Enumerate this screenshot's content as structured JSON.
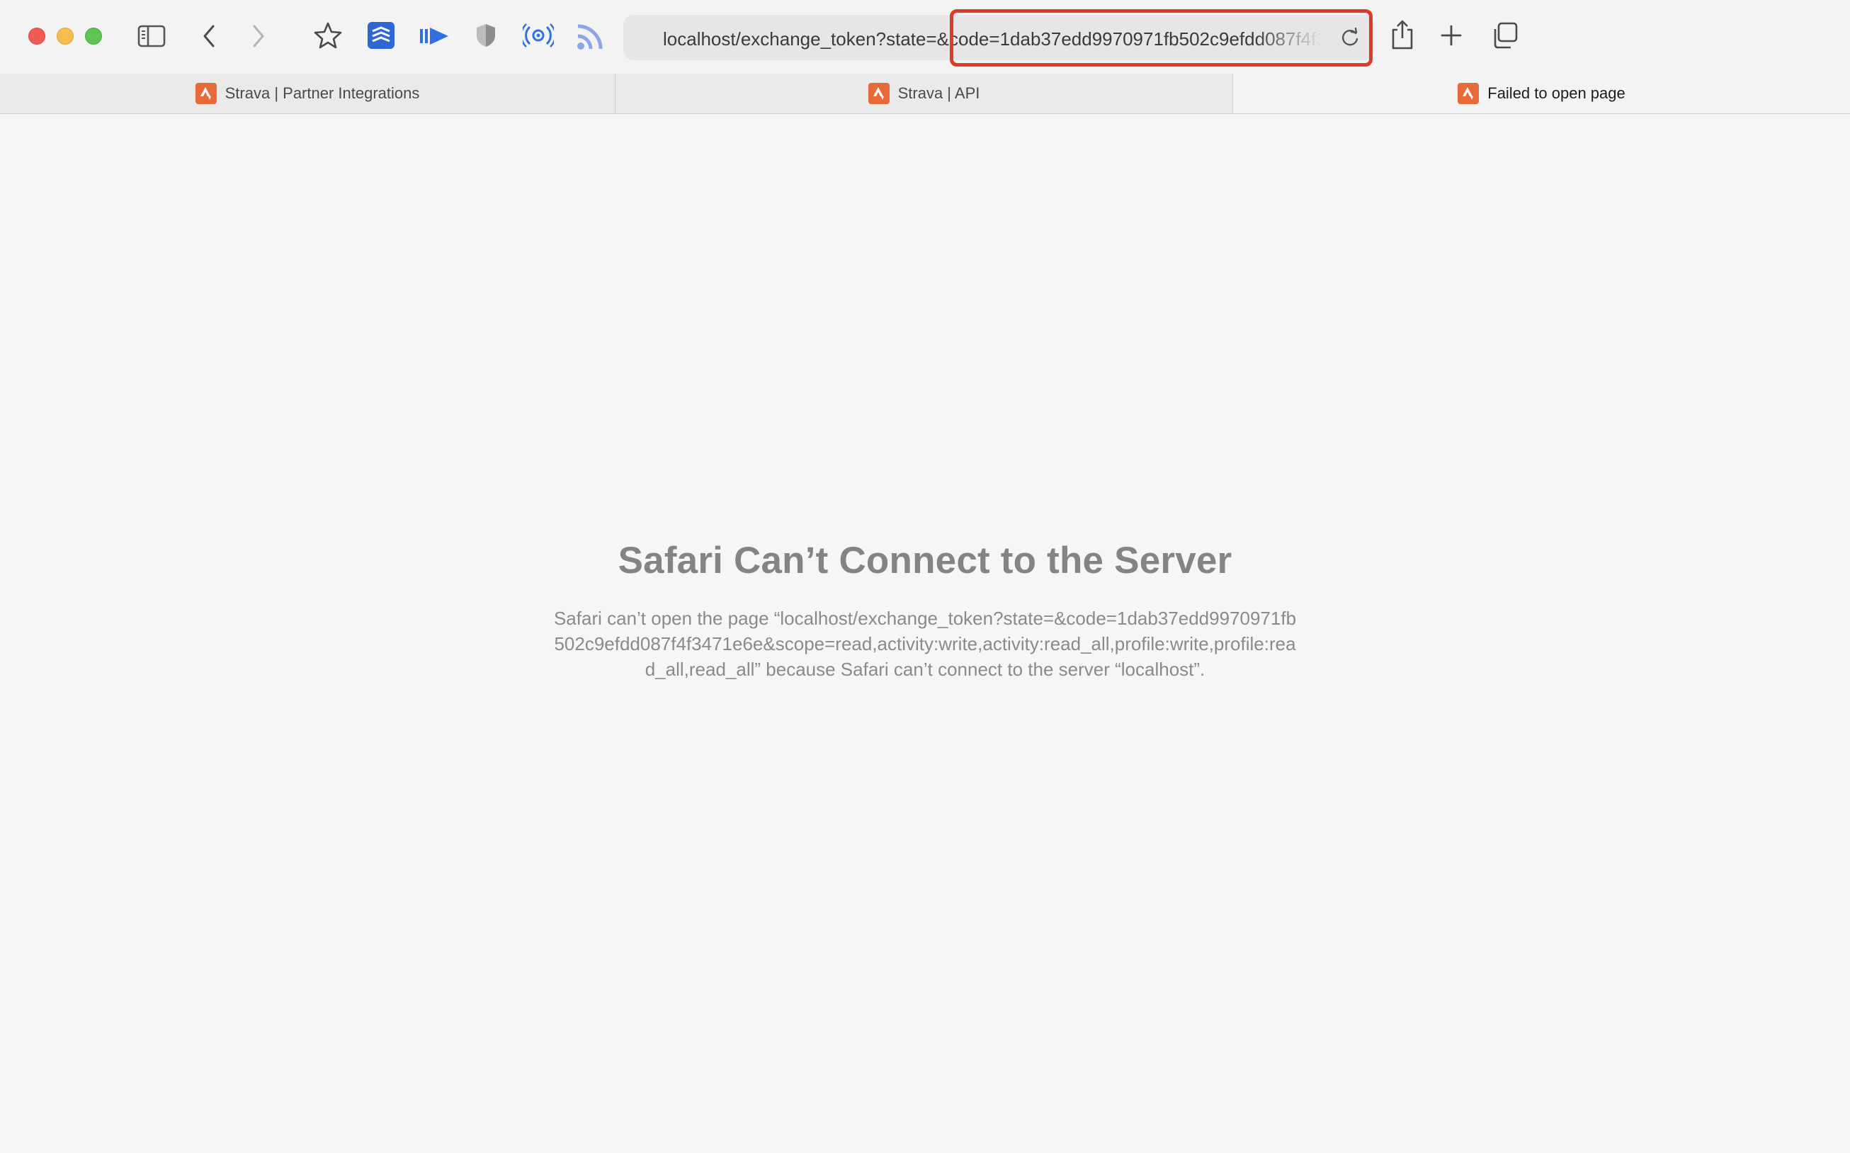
{
  "browser": {
    "url": "localhost/exchange_token?state=&code=1dab37edd9970971fb502c9efdd087f4f3471e6e&scope=read,activity:write,activity:read_all,profile:write,profile:read_all,read_all",
    "accent_color": "#e86a3a"
  },
  "tabs": [
    {
      "label": "Strava | Partner Integrations",
      "active": false,
      "icon": "strava-icon"
    },
    {
      "label": "Strava | API",
      "active": false,
      "icon": "strava-icon"
    },
    {
      "label": "Failed to open page",
      "active": true,
      "icon": "strava-icon"
    }
  ],
  "toolbar_icons": [
    "sidebar-icon",
    "back-icon",
    "forward-icon",
    "bookmark-star-icon",
    "todoist-icon",
    "readwise-icon",
    "privacy-shield-icon",
    "ear-icon",
    "rss-icon",
    "reload-icon",
    "share-icon",
    "new-tab-icon",
    "tab-overview-icon"
  ],
  "error": {
    "title": "Safari Can’t Connect to the Server",
    "message": "Safari can’t open the page “localhost/exchange_token?state=&code=1dab37edd9970971fb502c9efdd087f4f3471e6e&scope=read,activity:write,activity:read_all,profile:write,profile:read_all,read_all” because Safari can’t connect to the server “localhost”."
  }
}
